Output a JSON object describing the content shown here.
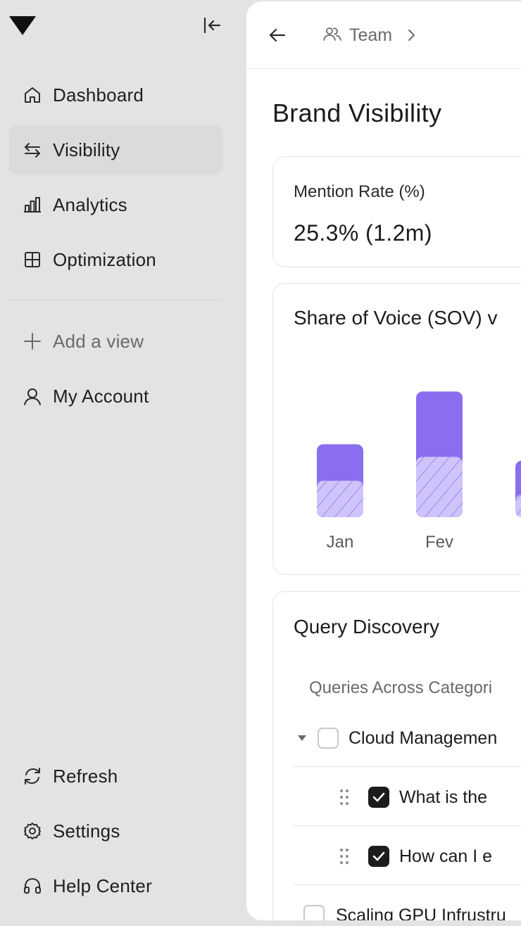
{
  "sidebar": {
    "nav": [
      {
        "label": "Dashboard",
        "icon": "home-icon"
      },
      {
        "label": "Visibility",
        "icon": "arrows-swap-icon",
        "active": true
      },
      {
        "label": "Analytics",
        "icon": "bar-chart-icon"
      },
      {
        "label": "Optimization",
        "icon": "grid-icon"
      }
    ],
    "add_view": "Add a view",
    "my_account": "My Account",
    "bottom": [
      {
        "label": "Refresh",
        "icon": "refresh-icon"
      },
      {
        "label": "Settings",
        "icon": "gear-icon"
      },
      {
        "label": "Help Center",
        "icon": "headphones-icon"
      }
    ]
  },
  "header": {
    "breadcrumb": "Team"
  },
  "page": {
    "title": "Brand Visibility"
  },
  "metric": {
    "label": "Mention Rate (%)",
    "value": "25.3% (1.2m)"
  },
  "chart": {
    "title": "Share of Voice (SOV) v"
  },
  "chart_data": {
    "type": "bar",
    "title": "Share of Voice (SOV) v",
    "categories": [
      "Jan",
      "Fev",
      ""
    ],
    "series": [
      {
        "values": [
          29,
          48,
          18
        ]
      },
      {
        "values": [
          29,
          52,
          27
        ]
      }
    ],
    "stacked": true,
    "ylim": [
      0,
      140
    ],
    "grid": false,
    "colors": {
      "solid": "#8b6df0",
      "hatched": "#cfc3fb",
      "hatch_line": "#7a63d9"
    }
  },
  "query": {
    "title": "Query Discovery",
    "column": "Queries Across Categori",
    "rows": [
      {
        "text": "Cloud Managemen",
        "checked": false,
        "kind": "group"
      },
      {
        "text": "What is the ",
        "checked": true,
        "kind": "child"
      },
      {
        "text": "How can I e",
        "checked": true,
        "kind": "child"
      },
      {
        "text": "Scaling GPU Infrustru",
        "checked": false,
        "kind": "group-collapsed"
      }
    ]
  },
  "colors": {
    "sidebar_bg": "#e3e3e3",
    "active_item_bg": "#dbdbdb",
    "accent": "#8b6df0"
  }
}
